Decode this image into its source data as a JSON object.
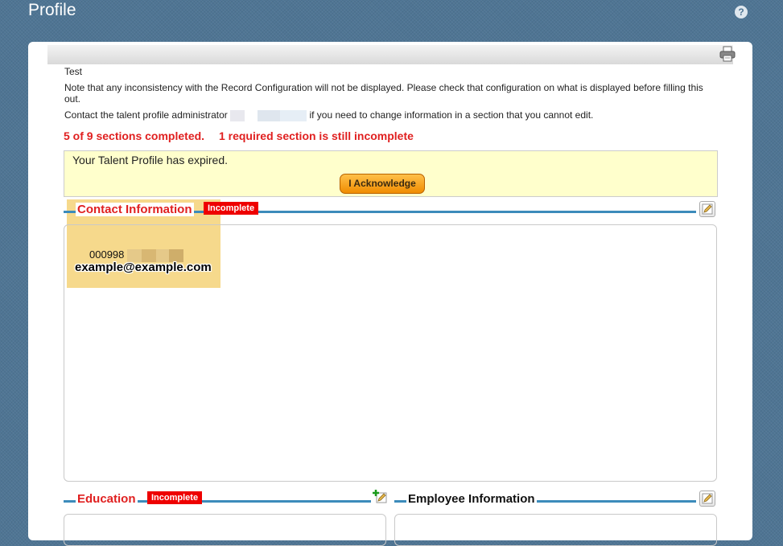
{
  "header": {
    "title": "Profile",
    "help_icon": "question-icon"
  },
  "toolbar": {
    "print_icon": "printer-icon"
  },
  "intro": {
    "test_label": "Test",
    "note": "Note that any inconsistency with the Record Configuration will not be displayed. Please check that configuration on what is displayed before filling this out.",
    "contact_prefix": "Contact the talent profile administrator",
    "contact_suffix": "if you need to change information in a section that you cannot edit."
  },
  "progress": {
    "completed": "5 of 9 sections completed.",
    "incomplete": "1 required section is still incomplete",
    "color": "#e02020"
  },
  "alert": {
    "message": "Your Talent Profile has expired.",
    "button_label": "I Acknowledge"
  },
  "sections": {
    "contact": {
      "title": "Contact Information",
      "badge": "Incomplete",
      "id_prefix": "000998",
      "email": "example@example.com"
    },
    "education": {
      "title": "Education",
      "badge": "Incomplete"
    },
    "employee": {
      "title": "Employee Information"
    }
  },
  "colors": {
    "accent_line": "#3c8bbb",
    "badge": "#ee0000",
    "alert_bg": "#ffffcc",
    "button": "#f08c00"
  }
}
